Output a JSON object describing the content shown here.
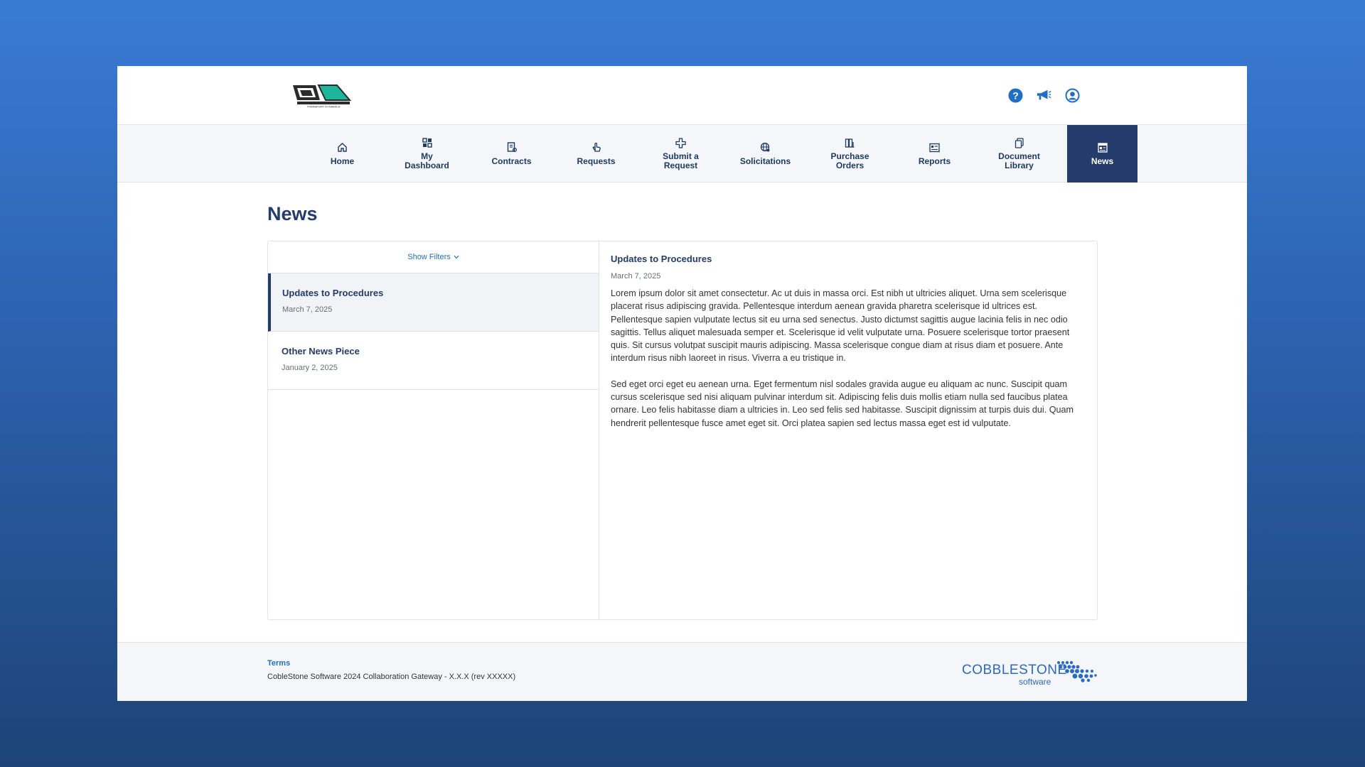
{
  "header": {
    "logo_text": "TRANSPORT DYNAMICS",
    "icons": [
      "help-icon",
      "megaphone-icon",
      "user-icon"
    ]
  },
  "nav": {
    "items": [
      {
        "label": "Home",
        "icon": "home-icon"
      },
      {
        "label": "My\nDashboard",
        "icon": "dashboard-icon"
      },
      {
        "label": "Contracts",
        "icon": "contracts-icon"
      },
      {
        "label": "Requests",
        "icon": "hand-pointer-icon"
      },
      {
        "label": "Submit a\nRequest",
        "icon": "plus-icon"
      },
      {
        "label": "Solicitations",
        "icon": "globe-icon"
      },
      {
        "label": "Purchase\nOrders",
        "icon": "purchase-orders-icon"
      },
      {
        "label": "Reports",
        "icon": "reports-icon"
      },
      {
        "label": "Document\nLibrary",
        "icon": "document-icon"
      },
      {
        "label": "News",
        "icon": "news-icon"
      }
    ],
    "active": "News"
  },
  "page": {
    "title": "News",
    "filters_label": "Show Filters"
  },
  "news_list": [
    {
      "title": "Updates to Procedures",
      "date": "March 7, 2025"
    },
    {
      "title": "Other News Piece",
      "date": "January 2, 2025"
    }
  ],
  "article": {
    "title": "Updates to Procedures",
    "date": "March 7, 2025",
    "paragraphs": [
      "Lorem ipsum dolor sit amet consectetur. Ac ut duis in massa orci. Est nibh ut ultricies aliquet. Urna sem scelerisque placerat risus adipiscing gravida. Pellentesque interdum aenean gravida pharetra scelerisque id ultrices est. Pellentesque sapien vulputate lectus sit eu urna sed senectus. Justo dictumst sagittis augue lacinia felis in nec odio sagittis. Tellus aliquet malesuada semper et. Scelerisque id velit vulputate urna. Posuere scelerisque tortor praesent quis. Sit cursus volutpat suscipit mauris adipiscing. Massa scelerisque congue diam at risus diam et posuere. Ante interdum risus nibh laoreet in risus. Viverra a eu tristique in.",
      "Sed eget orci eget eu aenean urna. Eget fermentum nisl sodales gravida augue eu aliquam ac nunc. Suscipit quam cursus scelerisque sed nisi aliquam pulvinar interdum sit. Adipiscing felis duis mollis etiam nulla sed faucibus platea ornare. Leo felis habitasse diam a ultricies in. Leo sed felis sed habitasse. Suscipit dignissim at turpis duis dui. Quam hendrerit pellentesque fusce amet eget sit. Orci platea sapien sed lectus massa eget est id vulputate."
    ]
  },
  "footer": {
    "terms": "Terms",
    "copyright": "CobleStone Software 2024 Collaboration Gateway - X.X.X (rev XXXXX)",
    "brand": "COBBLESTONE",
    "brand_sub": "software"
  },
  "colors": {
    "primary": "#243b6b",
    "link": "#1f6fc4",
    "accent_teal": "#1fb59a"
  }
}
